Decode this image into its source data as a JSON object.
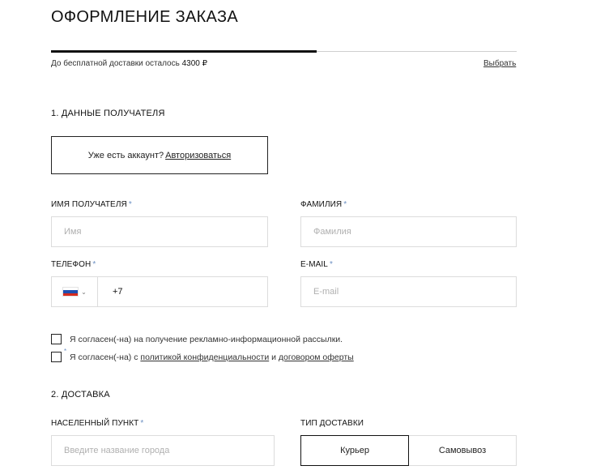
{
  "header": {
    "title": "ОФОРМЛЕНИЕ ЗАКАЗА"
  },
  "shipping": {
    "progress_fraction": 0.57,
    "note_prefix": "До бесплатной доставки осталось",
    "amount": "4300 ₽",
    "choose_link": "Выбрать"
  },
  "recipient": {
    "section_title": "1. ДАННЫЕ ПОЛУЧАТЕЛЯ",
    "account_prompt": "Уже есть аккаунт?",
    "login_link": "Авторизоваться",
    "first_name": {
      "label": "ИМЯ ПОЛУЧАТЕЛЯ",
      "required_mark": "*",
      "placeholder": "Имя"
    },
    "last_name": {
      "label": "ФАМИЛИЯ",
      "required_mark": "*",
      "placeholder": "Фамилия"
    },
    "phone": {
      "label": "ТЕЛЕФОН",
      "required_mark": "*",
      "value": "+7",
      "country_icon": "russia-flag-icon",
      "flag_colors": [
        "#ffffff",
        "#1f4fb0",
        "#d52b1e"
      ]
    },
    "email": {
      "label": "E-MAIL",
      "required_mark": "*",
      "placeholder": "E-mail"
    }
  },
  "consents": {
    "newsletter": {
      "text": "Я согласен(-на) на получение рекламно-информационной рассылки.",
      "checked": false
    },
    "terms": {
      "required_mark": "*",
      "text_prefix": "Я согласен(-на) с",
      "privacy_link": "политикой конфиденциальности",
      "conjunction": "и",
      "offer_link": "договором оферты",
      "checked": false
    }
  },
  "delivery": {
    "section_title": "2. ДОСТАВКА",
    "city": {
      "label": "НАСЕЛЕННЫЙ ПУНКТ",
      "required_mark": "*",
      "placeholder": "Введите название города"
    },
    "type": {
      "label": "ТИП ДОСТАВКИ",
      "options": [
        "Курьер",
        "Самовывоз"
      ],
      "selected": "Курьер"
    }
  },
  "colors": {
    "accent_required": "#6b8fc2",
    "progress": "#111111",
    "border": "#dcdcdc"
  }
}
